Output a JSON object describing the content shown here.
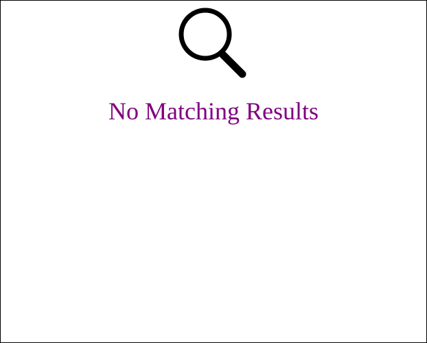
{
  "empty_state": {
    "icon": "search-icon",
    "message": "No Matching Results",
    "message_color": "#800080",
    "icon_color": "#000000"
  }
}
